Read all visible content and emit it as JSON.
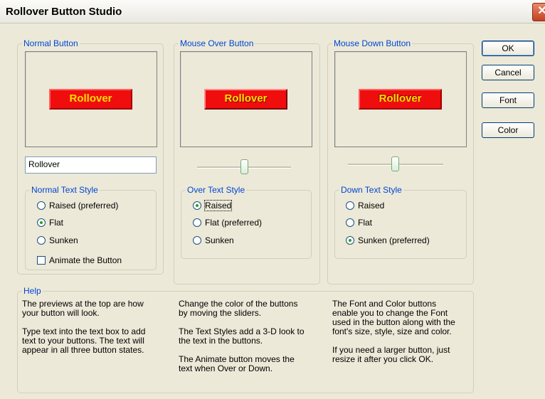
{
  "window": {
    "title": "Rollover Button Studio",
    "close_glyph": "✕"
  },
  "normal": {
    "group_label": "Normal Button",
    "preview_text": "Rollover",
    "text_value": "Rollover",
    "style_group_label": "Normal Text Style",
    "options": [
      "Raised (preferred)",
      "Flat",
      "Sunken"
    ],
    "selected": "Flat",
    "animate_label": "Animate the Button",
    "animate_checked": false
  },
  "over": {
    "group_label": "Mouse Over Button",
    "preview_text": "Rollover",
    "style_group_label": "Over Text Style",
    "options": [
      "Raised",
      "Flat (preferred)",
      "Sunken"
    ],
    "selected": "Raised",
    "slider_level": 0.5
  },
  "down": {
    "group_label": "Mouse Down Button",
    "preview_text": "Rollover",
    "style_group_label": "Down Text Style",
    "options": [
      "Raised",
      "Flat",
      "Sunken (preferred)"
    ],
    "selected": "Sunken (preferred)",
    "slider_level": 0.5
  },
  "buttons": {
    "ok": "OK",
    "cancel": "Cancel",
    "font": "Font",
    "color": "Color"
  },
  "help": {
    "group_label": "Help",
    "col1": "The previews at the top are how\nyour button will look.\n\nType text into the text box to add\ntext to your buttons. The text will\nappear in all three button states.",
    "col2": "Change the color of the buttons\nby moving the sliders.\n\nThe Text Styles add a 3-D look to\nthe text in the buttons.\n\nThe  Animate button moves the\ntext when Over or Down.",
    "col3": "The Font and Color buttons\nenable you to change the Font\nused in the button along with the\nfont's size, style, size and color.\n\nIf you need a larger button, just\nresize it after you click OK."
  },
  "colors": {
    "button_face": "#f00d0d",
    "button_text": "#ffdf00",
    "group_label": "#0046d5"
  }
}
